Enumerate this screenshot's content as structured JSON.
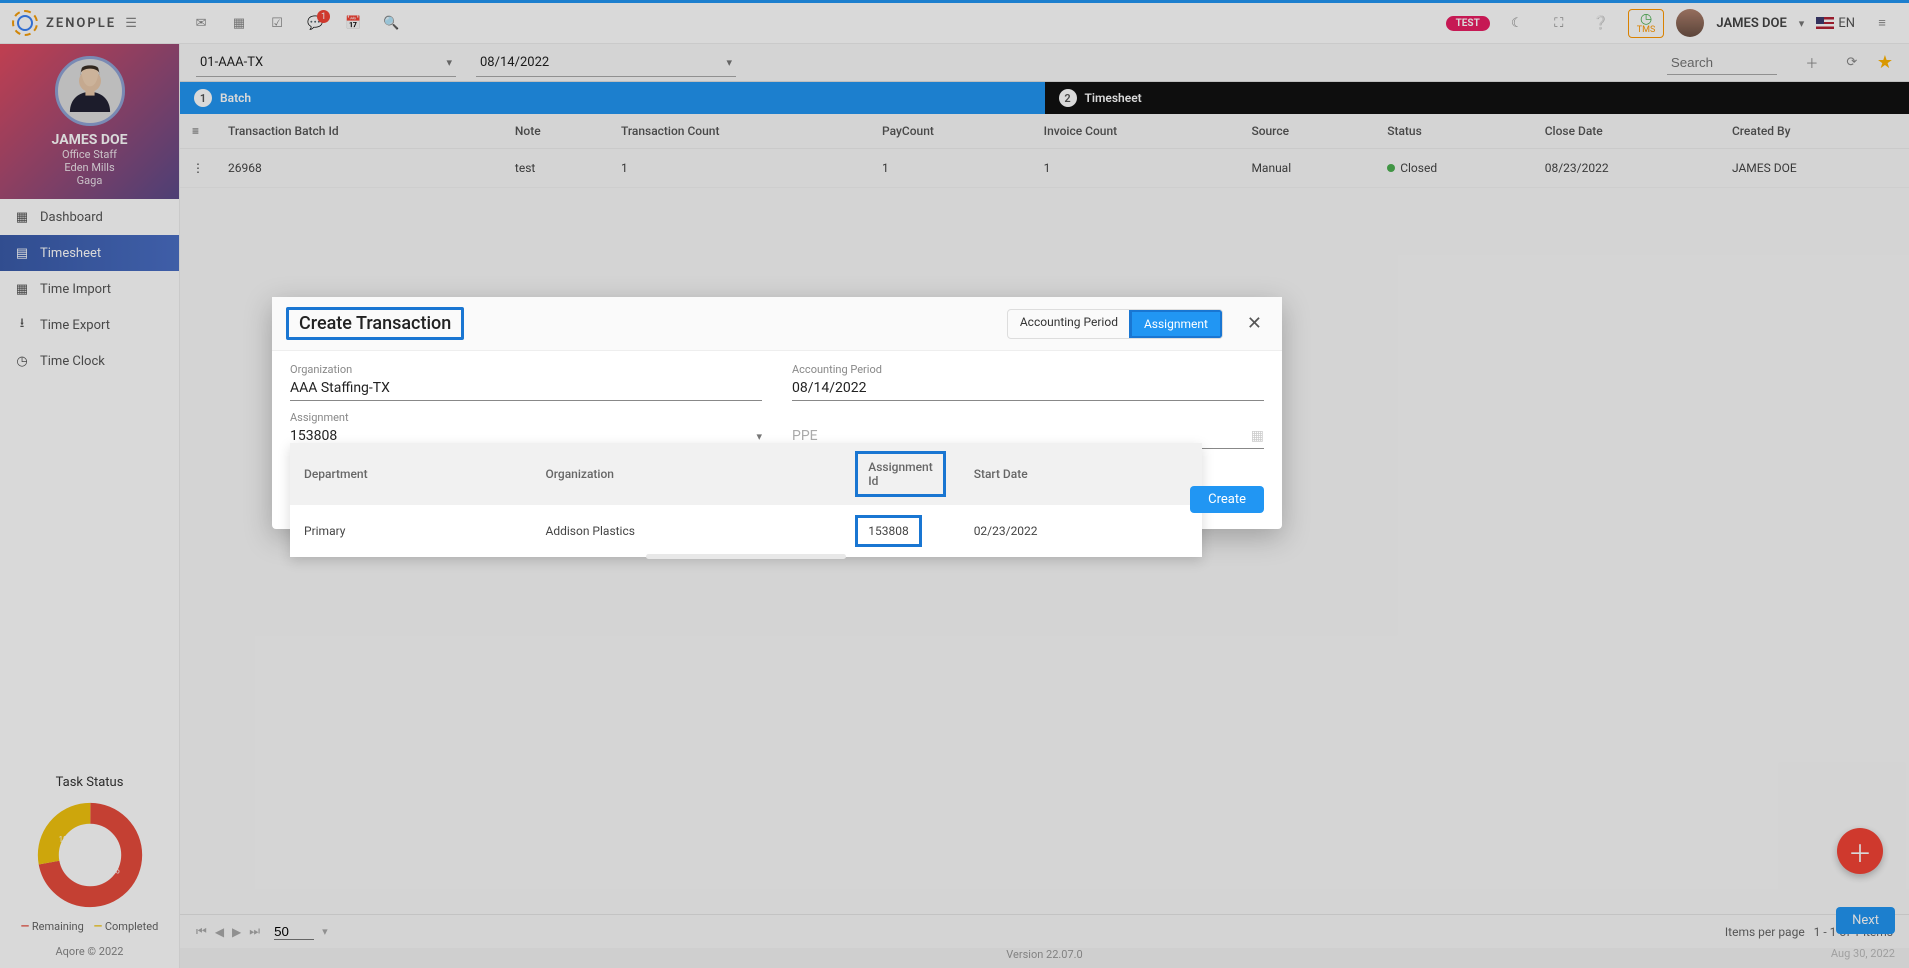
{
  "brand": "ZENOPLE",
  "header": {
    "notification_count": "1",
    "test_badge": "TEST",
    "tms_label": "TMS",
    "user_name": "JAMES DOE",
    "lang": "EN"
  },
  "profile": {
    "name": "JAMES DOE",
    "role": "Office Staff",
    "org": "Eden Mills",
    "loc": "Gaga"
  },
  "nav": {
    "dashboard": "Dashboard",
    "timesheet": "Timesheet",
    "time_import": "Time Import",
    "time_export": "Time Export",
    "time_clock": "Time Clock"
  },
  "task": {
    "title": "Task Status",
    "remaining_count": "26",
    "completed_count": "10",
    "remaining_label": "Remaining",
    "completed_label": "Completed"
  },
  "filter": {
    "org": "01-AAA-TX",
    "date": "08/14/2022",
    "search_placeholder": "Search"
  },
  "tabs": {
    "batch_num": "1",
    "batch_label": "Batch",
    "ts_num": "2",
    "ts_label": "Timesheet"
  },
  "grid": {
    "cols": {
      "id": "Transaction Batch Id",
      "note": "Note",
      "tcount": "Transaction Count",
      "pcount": "PayCount",
      "icount": "Invoice Count",
      "source": "Source",
      "status": "Status",
      "close": "Close Date",
      "created": "Created By"
    },
    "row": {
      "id": "26968",
      "note": "test",
      "tcount": "1",
      "pcount": "1",
      "icount": "1",
      "source": "Manual",
      "status": "Closed",
      "close": "08/23/2022",
      "created": "JAMES DOE"
    }
  },
  "pager": {
    "page_size": "50",
    "items_label": "Items per page",
    "items_range": "1 - 1 of 1 items"
  },
  "footer": {
    "copy": "Aqore © 2022",
    "version": "Version 22.07.0",
    "date": "Aug 30, 2022",
    "next": "Next"
  },
  "dialog": {
    "title": "Create Transaction",
    "tab_acc": "Accounting Period",
    "tab_assign": "Assignment",
    "fields": {
      "org_label": "Organization",
      "org_value": "AAA Staffing-TX",
      "acc_label": "Accounting Period",
      "acc_value": "08/14/2022",
      "assign_label": "Assignment",
      "assign_value": "153808",
      "ppe_placeholder": "PPE"
    },
    "dropdown": {
      "cols": {
        "dept": "Department",
        "org": "Organization",
        "aid": "Assignment Id",
        "start": "Start Date"
      },
      "row": {
        "dept": "Primary",
        "org": "Addison Plastics",
        "aid": "153808",
        "start": "02/23/2022"
      }
    },
    "create_btn": "Create"
  },
  "chart_data": {
    "type": "pie",
    "title": "Task Status",
    "series": [
      {
        "name": "Remaining",
        "value": 26,
        "color": "#e74c3c"
      },
      {
        "name": "Completed",
        "value": 10,
        "color": "#f1c40f"
      }
    ]
  }
}
